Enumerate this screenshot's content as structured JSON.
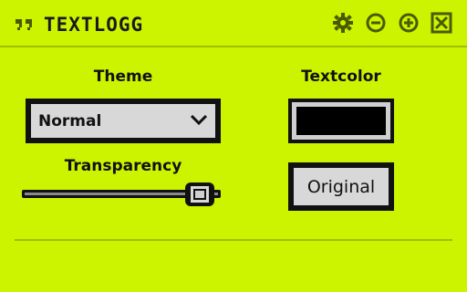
{
  "window": {
    "title": "TEXTLOGG",
    "background_color": "#ccf400"
  },
  "title_controls": [
    {
      "name": "settings",
      "icon": "gear-icon"
    },
    {
      "name": "minimize",
      "icon": "minus-circle-icon"
    },
    {
      "name": "add",
      "icon": "plus-circle-icon"
    },
    {
      "name": "close",
      "icon": "close-box-icon"
    }
  ],
  "theme": {
    "label": "Theme",
    "selected": "Normal"
  },
  "textcolor": {
    "label": "Textcolor",
    "color": "#000000"
  },
  "transparency": {
    "label": "Transparency",
    "value_percent": 96
  },
  "original_button": {
    "label": "Original"
  }
}
